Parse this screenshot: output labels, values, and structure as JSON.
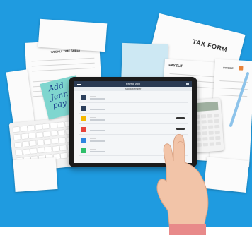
{
  "documents": {
    "timesheet_title": "WEEKLY TIME SHEET",
    "tax_form_title": "TAX FORM",
    "payslip_title": "PAYSLIP",
    "invoice_title": "INVOICE"
  },
  "sticky_note": {
    "text": "Add\nJenny's\npay"
  },
  "tablet_app": {
    "app_title": "Payroll App",
    "sub_title": "Add a Member",
    "rows": [
      {
        "label": "———",
        "color": "#2b3f5c",
        "has_button": false
      },
      {
        "label": "———",
        "color": "#2b3f5c",
        "has_button": false
      },
      {
        "label": "———",
        "color": "#f5b800",
        "has_button": true
      },
      {
        "label": "———",
        "color": "#e8433b",
        "has_button": true
      },
      {
        "label": "———",
        "color": "#2d86e0",
        "has_button": false
      },
      {
        "label": "———",
        "color": "#2fbf6b",
        "has_button": false
      }
    ]
  },
  "colors": {
    "background": "#1f9be0",
    "tablet_bezel": "#1b1b1b",
    "sticky_note": "#7fd6cf",
    "app_bar": "#2a3a52"
  }
}
